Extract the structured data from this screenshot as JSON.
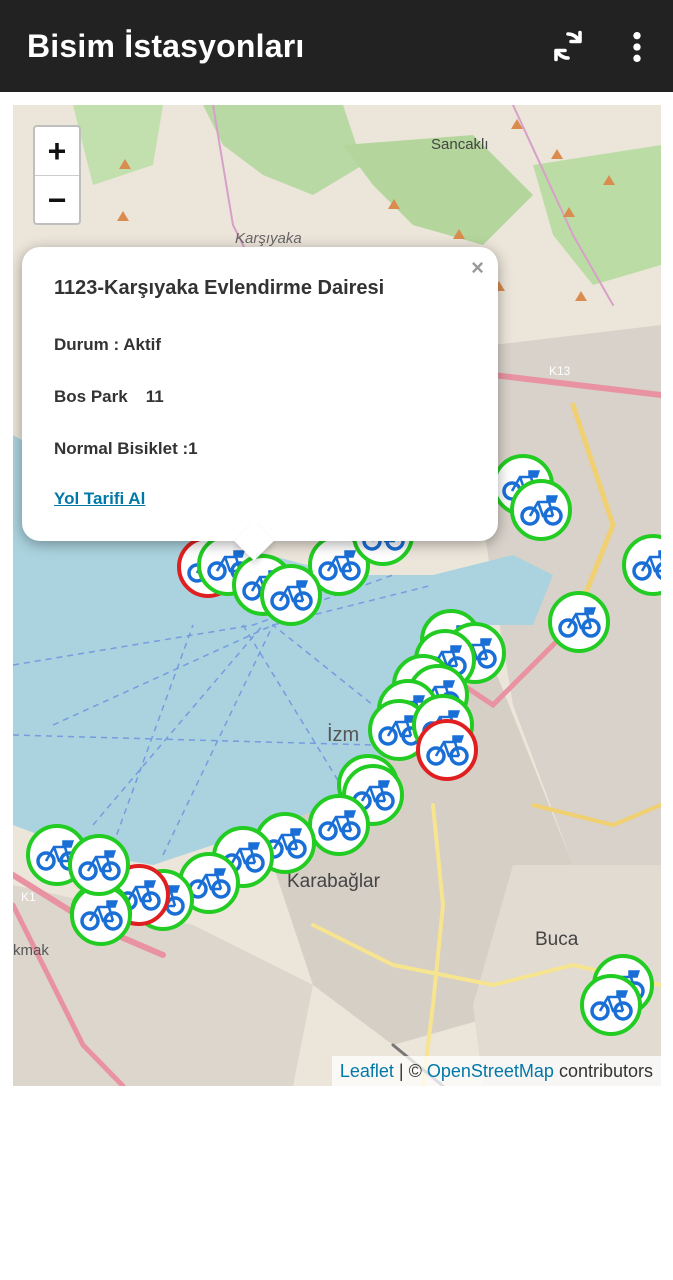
{
  "appbar": {
    "title": "Bisim İstasyonları",
    "refresh_icon": "refresh-icon",
    "more_icon": "more-vert-icon"
  },
  "map": {
    "zoom_in": "+",
    "zoom_out": "−",
    "labels": [
      "Sancaklı",
      "Karşıyaka",
      "İzm",
      "Karabağlar",
      "Buca",
      "kmak",
      "K13",
      "K1"
    ],
    "popup": {
      "title": "1123-Karşıyaka Evlendirme Dairesi",
      "status": "Durum : Aktif",
      "bos_park_label": "Bos Park",
      "bos_park_value": "11",
      "normal_bike": "Normal Bisiklet :1",
      "directions_link": "Yol Tarifi Al",
      "close": "×"
    },
    "attribution": {
      "leaflet": "Leaflet",
      "sep": " | © ",
      "osm": "OpenStreetMap",
      "suffix": " contributors"
    },
    "marker_colors": {
      "active": "#22cc22",
      "inactive": "#e02020",
      "bike": "#1a6fd6"
    }
  }
}
